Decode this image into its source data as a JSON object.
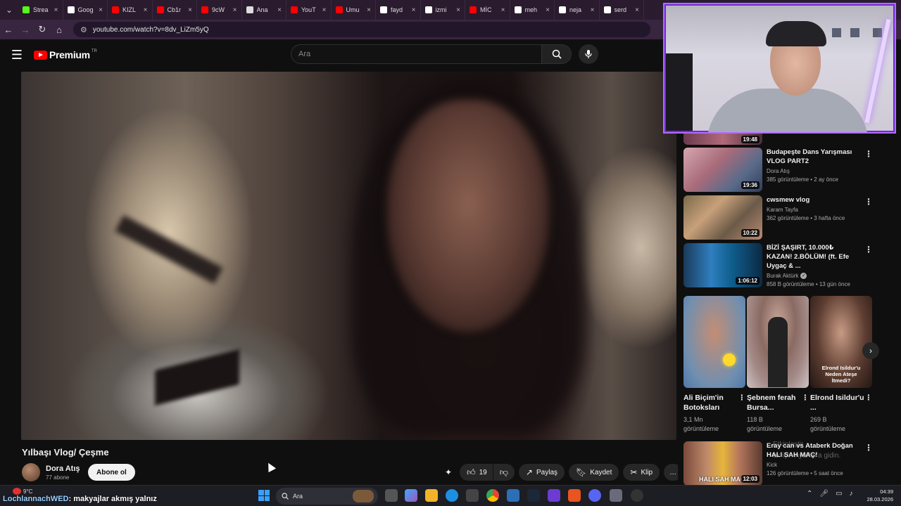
{
  "browser": {
    "tabs": [
      {
        "label": "Strea",
        "color": "#53fc18"
      },
      {
        "label": "Goog",
        "color": "#ffffff"
      },
      {
        "label": "KIZL",
        "color": "#ff0000"
      },
      {
        "label": "Cb1r",
        "color": "#ff0000"
      },
      {
        "label": "9cW",
        "color": "#ff0000"
      },
      {
        "label": "Ana",
        "color": "#dddddd"
      },
      {
        "label": "YouT",
        "color": "#ff0000"
      },
      {
        "label": "Umu",
        "color": "#ff0000"
      },
      {
        "label": "fayd",
        "color": "#ffffff"
      },
      {
        "label": "izmi",
        "color": "#ffffff"
      },
      {
        "label": "MİC",
        "color": "#ff0000"
      },
      {
        "label": "meh",
        "color": "#ffffff"
      },
      {
        "label": "neja",
        "color": "#ffffff"
      },
      {
        "label": "serd",
        "color": "#ffffff"
      }
    ],
    "url": "youtube.com/watch?v=8dv_LiZm5yQ"
  },
  "youtube": {
    "logo_text": "Premium",
    "logo_country": "TR",
    "search_placeholder": "Ara"
  },
  "video": {
    "title": "Yılbaşı Vlog/ Çeşme",
    "channel_name": "Dora Atış",
    "channel_subs": "77 abone",
    "subscribe_label": "Abone ol",
    "like_count": "19",
    "share_label": "Paylaş",
    "save_label": "Kaydet",
    "clip_label": "Klip",
    "more_label": "…"
  },
  "sidebar": {
    "partial_duration": "19:48",
    "recommendations": [
      {
        "title": "Budapeşte Dans Yarışması VLOG PART2",
        "channel": "Dora Atış",
        "stats": "385 görüntüleme • 2 ay önce",
        "duration": "19:36",
        "verified": false
      },
      {
        "title": "cwsmew vlog",
        "channel": "Karam Tayfa",
        "stats": "362 görüntüleme • 3 hafta önce",
        "duration": "10:22",
        "verified": false
      },
      {
        "title": "BİZİ ŞAŞIRT, 10.000₺ KAZAN! 2.BÖLÜM! (ft. Efe Uygaç & ...",
        "channel": "Burak Aktürk",
        "stats": "858 B görüntüleme • 13 gün önce",
        "duration": "1:06:12",
        "verified": true
      }
    ],
    "shorts": [
      {
        "title": "Ali Biçim'in Botoksları",
        "views_line1": "3,1 Mn",
        "views_line2": "görüntüleme"
      },
      {
        "title": "Şebnem ferah Bursa...",
        "views_line1": "118 B",
        "views_line2": "görüntüleme"
      },
      {
        "title": "Elrond Isildur'u ...",
        "views_line1": "269 B",
        "views_line2": "görüntüleme",
        "overlay": "Elrond Isildur'u Neden Ateşe İtmedi?"
      }
    ],
    "bottom_rec": {
      "title": "Eray can vs Ataberk Doğan HALI SAH MAÇ!",
      "overlay_hint": "Etkinleştir",
      "overlay_hint2": "ak için Ayarlar'a gidin.",
      "channel": "Kick",
      "stats": "126 görüntüleme • 5 saat önce",
      "duration": "12:03",
      "thumb_text": "HALI SAH MAÇI"
    }
  },
  "taskbar": {
    "weather": "9°C",
    "chat_user": "LochlannachWED",
    "chat_msg": ": makyajlar akmış yalnız",
    "search_label": "Ara",
    "time": "04:39",
    "date": "28.03.2026"
  },
  "colors": {
    "accent": "#ff0000",
    "webcam_border": "#b46bff"
  }
}
